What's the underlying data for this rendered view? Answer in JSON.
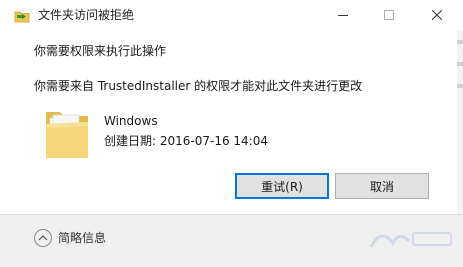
{
  "window": {
    "title": "文件夹访问被拒绝",
    "icon": "folder-shield-icon"
  },
  "messages": {
    "line1": "你需要权限来执行此操作",
    "line2": "你需要来自 TrustedInstaller 的权限才能对此文件夹进行更改"
  },
  "folder": {
    "icon": "folder-icon",
    "name": "Windows",
    "created": "创建日期: 2016-07-16 14:04"
  },
  "buttons": {
    "retry": "重试(R)",
    "cancel": "取消"
  },
  "footer": {
    "details_label": "简略信息"
  },
  "colors": {
    "focus_border": "#0078d7",
    "button_bg": "#e1e1e1",
    "footer_bg": "#f0f0f0",
    "folder_yellow": "#f5d57a"
  }
}
